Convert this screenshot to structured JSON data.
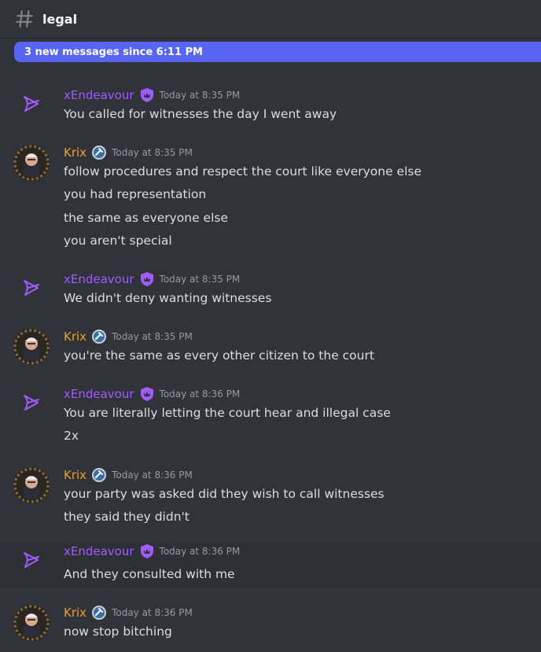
{
  "channel": {
    "name": "legal",
    "icon": "hash-icon"
  },
  "new_messages_bar": {
    "label": "3 new messages since 6:11 PM"
  },
  "colors": {
    "accent": "#5865f2",
    "xendeavour": "#a05cff",
    "krix": "#f0a030",
    "background": "#313338"
  },
  "messages": [
    {
      "author": "xEndeavour",
      "badge": "shield-crown-icon",
      "timestamp": "Today at 8:35 PM",
      "lines": [
        "You called for witnesses the day I went away"
      ]
    },
    {
      "author": "Krix",
      "badge": "gavel-badge-icon",
      "timestamp": "Today at 8:35 PM",
      "lines": [
        "follow procedures and respect the court like everyone else",
        "you had representation",
        "the same as everyone else",
        "you aren't special"
      ]
    },
    {
      "author": "xEndeavour",
      "badge": "shield-crown-icon",
      "timestamp": "Today at 8:35 PM",
      "lines": [
        "We didn't deny wanting witnesses"
      ]
    },
    {
      "author": "Krix",
      "badge": "gavel-badge-icon",
      "timestamp": "Today at 8:35 PM",
      "lines": [
        "you're the same as every other citizen to the court"
      ]
    },
    {
      "author": "xEndeavour",
      "badge": "shield-crown-icon",
      "timestamp": "Today at 8:36 PM",
      "lines": [
        "You are literally letting the court hear and illegal case",
        "2x"
      ]
    },
    {
      "author": "Krix",
      "badge": "gavel-badge-icon",
      "timestamp": "Today at 8:36 PM",
      "lines": [
        "your party was asked did they wish to call witnesses",
        "they said they didn't"
      ]
    },
    {
      "author": "xEndeavour",
      "badge": "shield-crown-icon",
      "timestamp": "Today at 8:36 PM",
      "lines": [
        "And they consulted with me"
      ]
    },
    {
      "author": "Krix",
      "badge": "gavel-badge-icon",
      "timestamp": "Today at 8:36 PM",
      "lines": [
        "now stop bitching"
      ]
    }
  ]
}
